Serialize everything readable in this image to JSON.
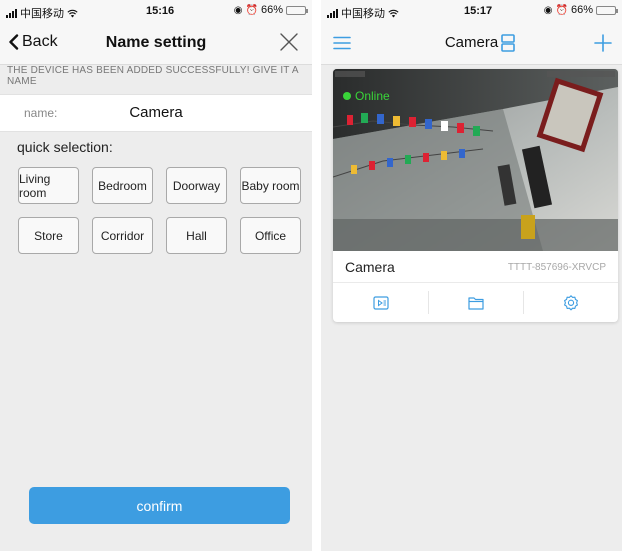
{
  "left_screen": {
    "status": {
      "carrier": "中国移动",
      "time": "15:16",
      "battery": "66%",
      "battery_level": 0.66
    },
    "nav": {
      "back_label": "Back",
      "title": "Name setting"
    },
    "notice": "THE DEVICE HAS BEEN ADDED SUCCESSFULLY! GIVE IT A NAME",
    "name_field": {
      "label": "name:",
      "value": "Camera"
    },
    "quick_selection_label": "quick selection:",
    "quick_options": [
      "Living room",
      "Bedroom",
      "Doorway",
      "Baby room",
      "Store",
      "Corridor",
      "Hall",
      "Office"
    ],
    "confirm_label": "confirm"
  },
  "right_screen": {
    "status": {
      "carrier": "中国移动",
      "time": "15:17",
      "battery": "66%",
      "battery_level": 0.66
    },
    "nav": {
      "title": "Camera"
    },
    "device": {
      "status_label": "Online",
      "name": "Camera",
      "id": "TTTT-857696-XRVCP"
    },
    "card_actions": [
      "playback-icon",
      "folder-icon",
      "settings-gear-icon"
    ]
  },
  "colors": {
    "accent": "#3d9de1",
    "online": "#39d439"
  }
}
